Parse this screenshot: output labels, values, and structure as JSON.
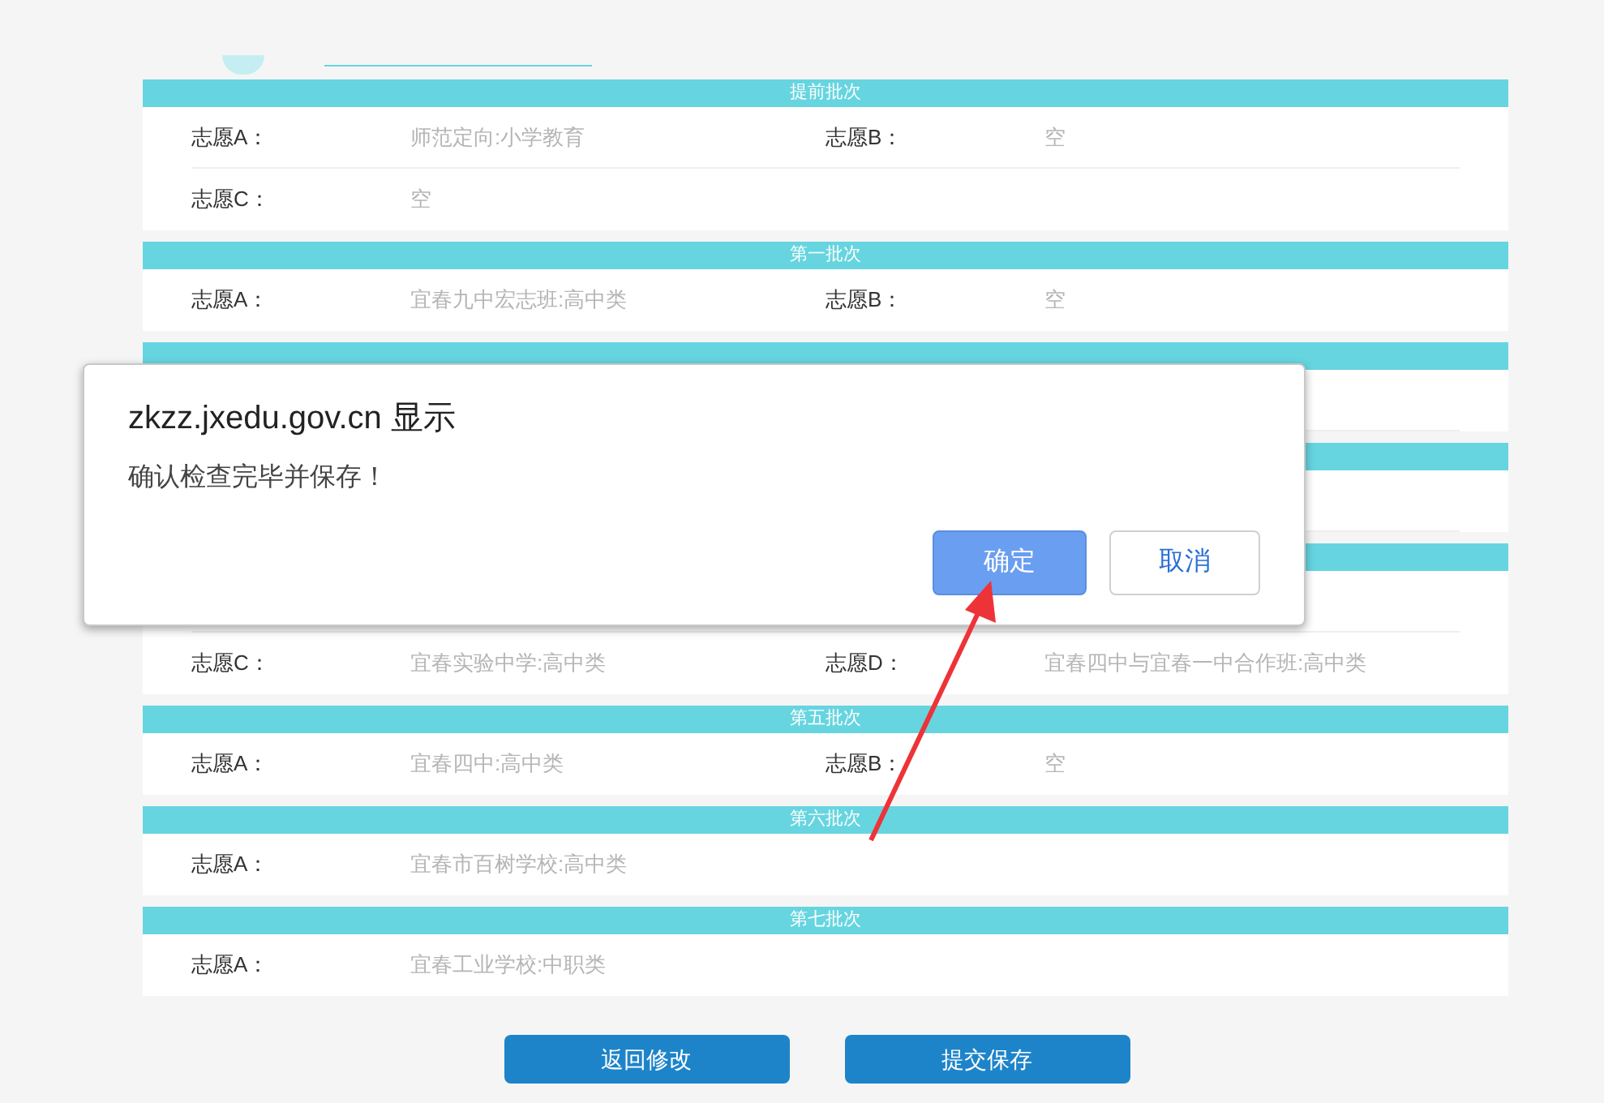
{
  "sections": [
    {
      "title": "提前批次",
      "rows": [
        [
          {
            "label": "志愿A：",
            "value": "师范定向:小学教育"
          },
          {
            "label": "志愿B：",
            "value": "空"
          }
        ],
        [
          {
            "label": "志愿C：",
            "value": "空"
          }
        ]
      ]
    },
    {
      "title": "第一批次",
      "rows": [
        [
          {
            "label": "志愿A：",
            "value": "宜春九中宏志班:高中类"
          },
          {
            "label": "志愿B：",
            "value": "空"
          }
        ]
      ]
    },
    {
      "covered": true
    },
    {
      "covered": true
    },
    {
      "covered": true,
      "rows": [
        [
          {
            "label": "志愿C：",
            "value": "宜春实验中学:高中类"
          },
          {
            "label": "志愿D：",
            "value": "宜春四中与宜春一中合作班:高中类"
          }
        ]
      ]
    },
    {
      "title": "第五批次",
      "rows": [
        [
          {
            "label": "志愿A：",
            "value": "宜春四中:高中类"
          },
          {
            "label": "志愿B：",
            "value": "空"
          }
        ]
      ]
    },
    {
      "title": "第六批次",
      "rows": [
        [
          {
            "label": "志愿A：",
            "value": "宜春市百树学校:高中类"
          }
        ]
      ]
    },
    {
      "title": "第七批次",
      "rows": [
        [
          {
            "label": "志愿A：",
            "value": "宜春工业学校:中职类"
          }
        ]
      ]
    }
  ],
  "buttons": [
    "返回修改",
    "提交保存"
  ],
  "dialog": {
    "title": "zkzz.jxedu.gov.cn 显示",
    "message": "确认检查完毕并保存！",
    "buttons": [
      {
        "label": "确定",
        "kind": "primary"
      },
      {
        "label": "取消",
        "kind": "secondary"
      }
    ]
  }
}
